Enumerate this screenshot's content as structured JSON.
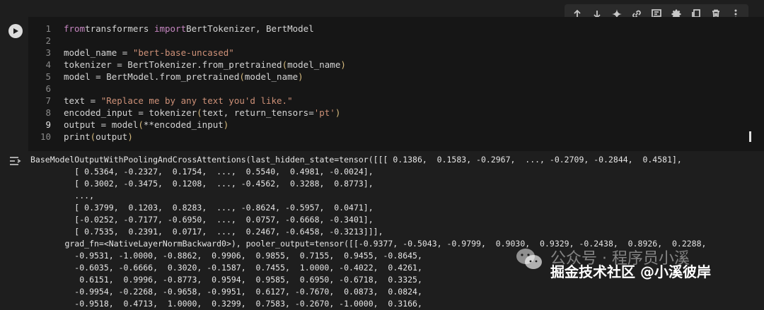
{
  "toolbar": {
    "icons": [
      "arrow-up-icon",
      "arrow-down-icon",
      "sparkle-icon",
      "link-icon",
      "comment-icon",
      "gear-icon",
      "mirror-icon",
      "trash-icon",
      "more-icon"
    ]
  },
  "cell": {
    "active_line": 9,
    "lines": [
      {
        "n": "1",
        "segments": [
          [
            "kw",
            "from"
          ],
          [
            "",
            "transformers "
          ],
          [
            "kw",
            "import"
          ],
          [
            "",
            "BertTokenizer, BertModel"
          ]
        ]
      },
      {
        "n": "2",
        "segments": []
      },
      {
        "n": "3",
        "segments": [
          [
            "",
            "model_name = "
          ],
          [
            "str",
            "\"bert-base-uncased\""
          ]
        ]
      },
      {
        "n": "4",
        "segments": [
          [
            "",
            "tokenizer = BertTokenizer.from_pretrained"
          ],
          [
            "pr",
            "("
          ],
          [
            "",
            "model_name"
          ],
          [
            "pr",
            ")"
          ]
        ]
      },
      {
        "n": "5",
        "segments": [
          [
            "",
            "model = BertModel.from_pretrained"
          ],
          [
            "pr",
            "("
          ],
          [
            "",
            "model_name"
          ],
          [
            "pr",
            ")"
          ]
        ]
      },
      {
        "n": "6",
        "segments": []
      },
      {
        "n": "7",
        "segments": [
          [
            "",
            "text = "
          ],
          [
            "str",
            "\"Replace me by any text you'd like.\""
          ]
        ]
      },
      {
        "n": "8",
        "segments": [
          [
            "",
            "encoded_input = tokenizer"
          ],
          [
            "pr",
            "("
          ],
          [
            "",
            "text, return_tensors="
          ],
          [
            "str",
            "'pt'"
          ],
          [
            "pr",
            ")"
          ]
        ]
      },
      {
        "n": "9",
        "segments": [
          [
            "",
            "output = model"
          ],
          [
            "pr",
            "("
          ],
          [
            "",
            "**encoded_input"
          ],
          [
            "pr",
            ")"
          ]
        ]
      },
      {
        "n": "10",
        "segments": [
          [
            "",
            "print"
          ],
          [
            "pr",
            "("
          ],
          [
            "",
            "output"
          ],
          [
            "pr",
            ")"
          ]
        ]
      }
    ]
  },
  "output": {
    "lines": [
      "BaseModelOutputWithPoolingAndCrossAttentions(last_hidden_state=tensor([[[ 0.1386,  0.1583, -0.2967,  ..., -0.2709, -0.2844,  0.4581],",
      "         [ 0.5364, -0.2327,  0.1754,  ...,  0.5540,  0.4981, -0.0024],",
      "         [ 0.3002, -0.3475,  0.1208,  ..., -0.4562,  0.3288,  0.8773],",
      "         ...,",
      "         [ 0.3799,  0.1203,  0.8283,  ..., -0.8624, -0.5957,  0.0471],",
      "         [-0.0252, -0.7177, -0.6950,  ...,  0.0757, -0.6668, -0.3401],",
      "         [ 0.7535,  0.2391,  0.0717,  ...,  0.2467, -0.6458, -0.3213]]],",
      "       grad_fn=<NativeLayerNormBackward0>), pooler_output=tensor([[-0.9377, -0.5043, -0.9799,  0.9030,  0.9329, -0.2438,  0.8926,  0.2288,",
      "         -0.9531, -1.0000, -0.8862,  0.9906,  0.9855,  0.7155,  0.9455, -0.8645,",
      "         -0.6035, -0.6666,  0.3020, -0.1587,  0.7455,  1.0000, -0.4022,  0.4261,",
      "          0.6151,  0.9996, -0.8773,  0.9594,  0.9585,  0.6950, -0.6718,  0.3325,",
      "         -0.9954, -0.2268, -0.9658, -0.9951,  0.6127, -0.7670,  0.0873,  0.0824,",
      "         -0.9518,  0.4713,  1.0000,  0.3299,  0.7583, -0.2670, -1.0000,  0.3166,"
    ]
  },
  "watermark": {
    "line1": "公众号 · 程序员小溪",
    "line2": "掘金技术社区 @小溪彼岸"
  }
}
